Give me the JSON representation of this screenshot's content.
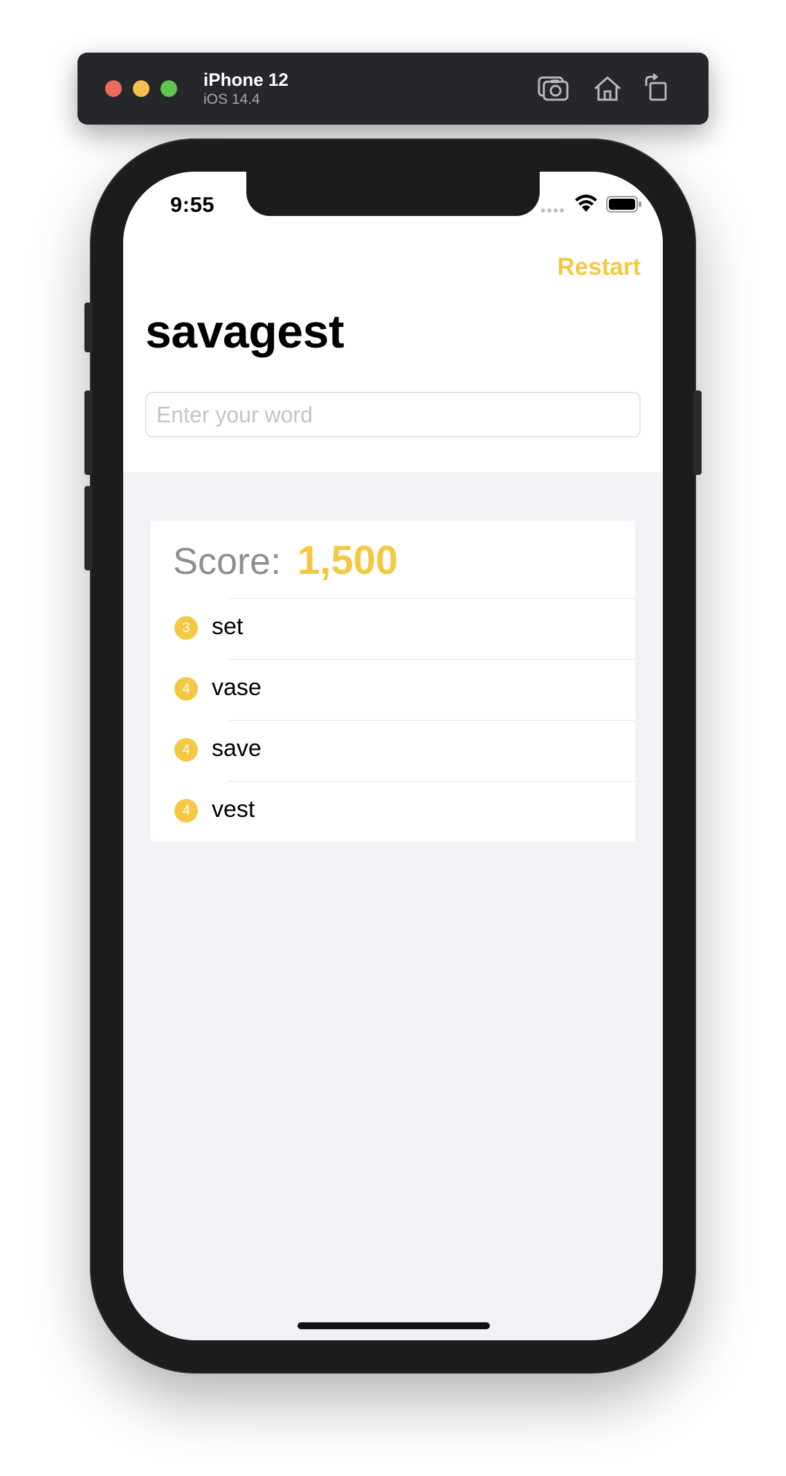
{
  "simulator": {
    "device_name": "iPhone 12",
    "os_version": "iOS 14.4",
    "toolbar_icons": [
      "screenshot-icon",
      "home-icon",
      "rotate-icon"
    ]
  },
  "status_bar": {
    "time": "9:55",
    "icons": [
      "cellular-signal-icon",
      "wifi-icon",
      "battery-icon"
    ]
  },
  "nav": {
    "restart_label": "Restart",
    "title": "savagest"
  },
  "input": {
    "placeholder": "Enter your word",
    "value": ""
  },
  "score": {
    "label": "Score:",
    "value": "1,500"
  },
  "words": [
    {
      "points": "3",
      "word": "set"
    },
    {
      "points": "4",
      "word": "vase"
    },
    {
      "points": "4",
      "word": "save"
    },
    {
      "points": "4",
      "word": "vest"
    }
  ],
  "colors": {
    "accent": "#f5c842",
    "background": "#f1f1f6",
    "text_secondary": "#8e8e93"
  }
}
